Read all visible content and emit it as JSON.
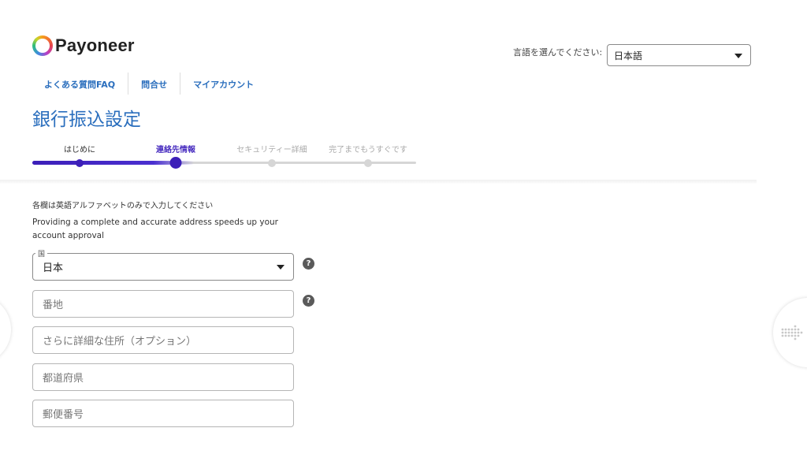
{
  "brand": {
    "name": "Payoneer"
  },
  "language": {
    "label": "言語を選んでください:",
    "selected": "日本語"
  },
  "nav": {
    "items": [
      {
        "label": "よくある質問FAQ"
      },
      {
        "label": "問合せ"
      },
      {
        "label": "マイアカウント"
      }
    ]
  },
  "page": {
    "title": "銀行振込設定"
  },
  "steps": {
    "items": [
      {
        "label": "はじめに",
        "state": "done"
      },
      {
        "label": "連絡先情報",
        "state": "active"
      },
      {
        "label": "セキュリティー詳細",
        "state": "todo"
      },
      {
        "label": "完了までもうすぐです",
        "state": "todo"
      }
    ]
  },
  "form": {
    "note": "各欄は英語アルファベットのみで入力してください",
    "info": "Providing a complete and accurate address speeds up your account approval",
    "country": {
      "label": "国",
      "value": "日本"
    },
    "address1": {
      "placeholder": "番地"
    },
    "address2": {
      "placeholder": "さらに詳細な住所（オプション）"
    },
    "prefecture": {
      "placeholder": "都道府県"
    },
    "postal": {
      "placeholder": "郵便番号"
    },
    "help_glyph": "?"
  },
  "colors": {
    "accent": "#2a6ebd",
    "progress": "#3c1fb8",
    "progress_track": "#d6d6d6"
  }
}
